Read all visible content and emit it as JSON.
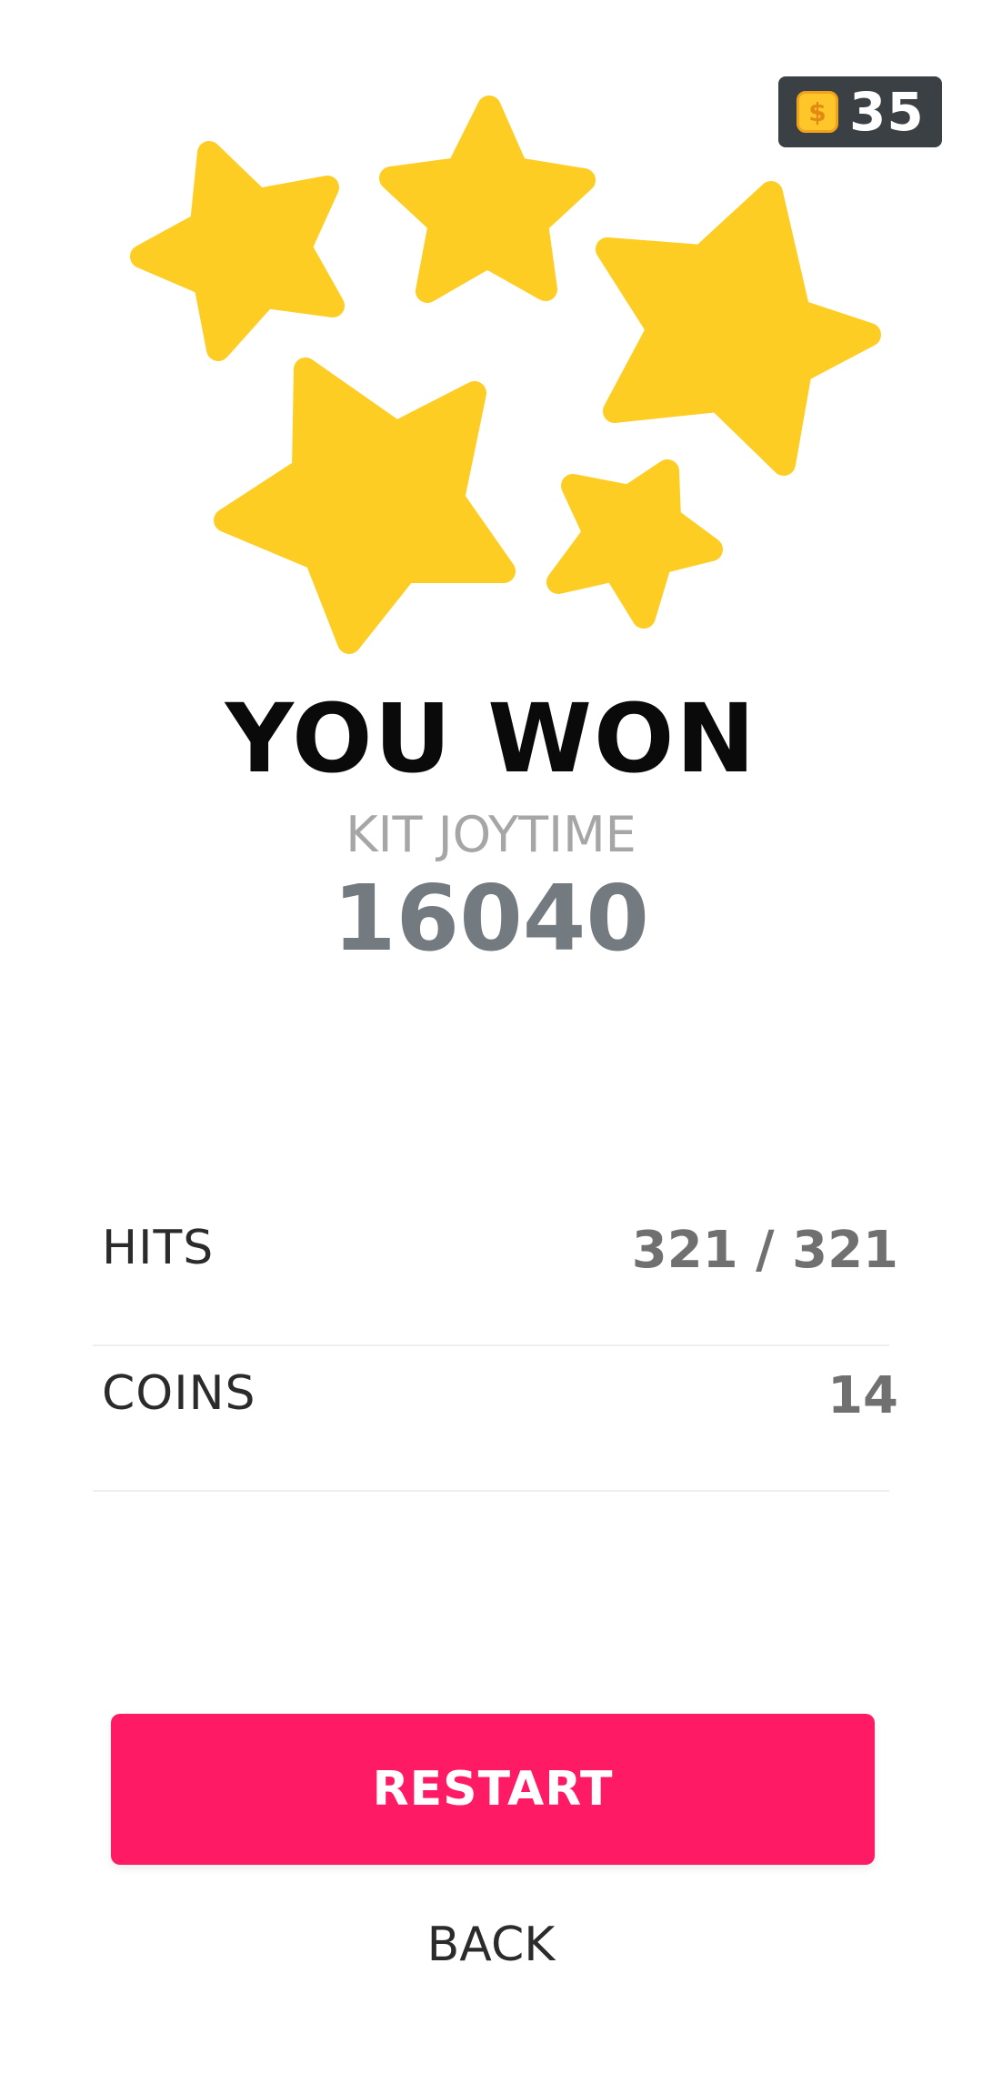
{
  "wallet": {
    "coin_icon": "coin-icon",
    "coin_symbol": "$",
    "balance": "35"
  },
  "result": {
    "title": "YOU WON",
    "level_name": "KIT JOYTIME",
    "score": "16040"
  },
  "stats": {
    "hits_label": "HITS",
    "hits_value": "321 / 321",
    "coins_label": "COINS",
    "coins_value": "14"
  },
  "actions": {
    "restart_label": "RESTART",
    "back_label": "BACK"
  },
  "colors": {
    "star": "#fdcd24",
    "restart": "#ff1a66",
    "badge": "#3b4044"
  }
}
